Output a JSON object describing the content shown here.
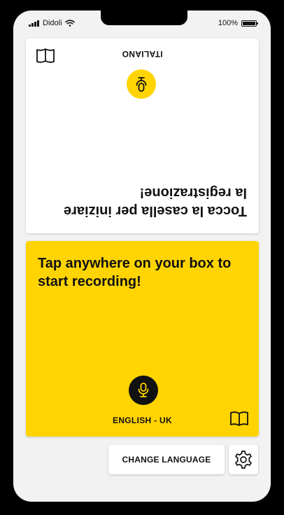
{
  "status_bar": {
    "carrier": "Didoli",
    "battery": "100%"
  },
  "top_panel": {
    "language": "ITALIANO",
    "prompt": "Tocca la casella per iniziare la registrazione!",
    "background": "#ffffff",
    "mic_color": "#ffd400",
    "icons": [
      "mic-icon",
      "book-icon"
    ]
  },
  "bottom_panel": {
    "language": "ENGLISH - UK",
    "prompt": "Tap anywhere on your box to start recording!",
    "background": "#ffd400",
    "mic_color": "#111111",
    "icons": [
      "mic-icon",
      "book-icon"
    ]
  },
  "footer": {
    "change_language_label": "CHANGE LANGUAGE",
    "settings_icon": "gear-icon"
  }
}
